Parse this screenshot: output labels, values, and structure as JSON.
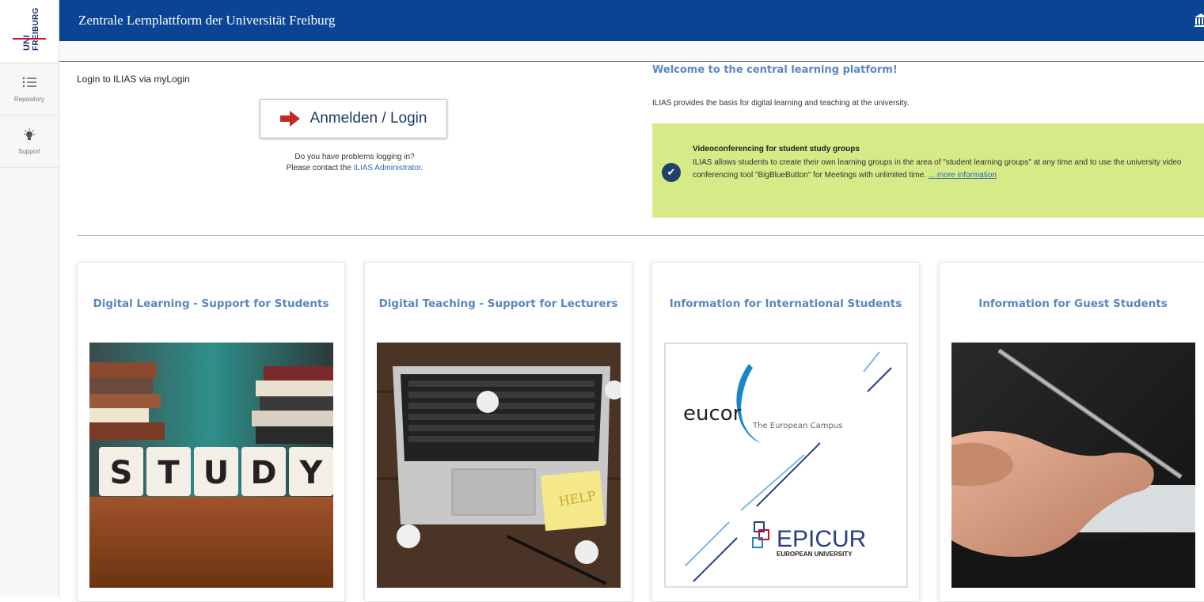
{
  "logo": {
    "line1": "UNI",
    "line2": "FREIBURG"
  },
  "sidebar": {
    "items": [
      {
        "label": "Repository",
        "icon": "list-icon"
      },
      {
        "label": "Support",
        "icon": "lightbulb-icon"
      }
    ]
  },
  "header": {
    "title": "Zentrale Lernplattform der Universität Freiburg",
    "right_icon": "building-icon"
  },
  "login": {
    "label": "Login to ILIAS via myLogin",
    "button_label": "Anmelden / Login",
    "help_line1": "Do you have problems logging in?",
    "help_line2_prefix": "Please contact the ",
    "help_link": "ILIAS Administrator",
    "help_line2_suffix": "."
  },
  "welcome": {
    "title": "Welcome to the central learning platform!",
    "text": "ILIAS provides the basis for digital learning and teaching at the university.",
    "notice": {
      "title": "Videoconferencing for student study groups",
      "body": "ILIAS allows students to create their own learning groups in the area of \"student learning groups\" at any time and to use the university video conferencing tool \"BigBlueButton\" for Meetings with unlimited time. ",
      "link": "... more information",
      "color": "#d6ea87"
    }
  },
  "cards": [
    {
      "title": "Digital Learning - Support for Students",
      "image_text": "STUDY"
    },
    {
      "title": "Digital Teaching - Support for Lecturers",
      "image_text": "HELP"
    },
    {
      "title": "Information for International Students",
      "logo1": "eucor",
      "logo1_sub": "The European Campus",
      "logo2": "EPICUR",
      "logo2_sub": "EUROPEAN UNIVERSITY"
    },
    {
      "title": "Information for Guest Students"
    }
  ],
  "colors": {
    "brand": "#0a4595",
    "accent": "#5b86c0",
    "notice": "#d6ea87",
    "logo_red": "#c8102e"
  }
}
